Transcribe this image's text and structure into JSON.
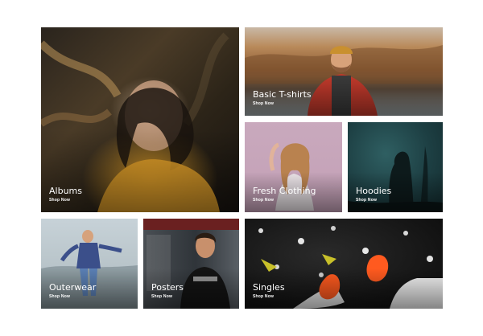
{
  "tiles": [
    {
      "title": "Albums",
      "link": "Shop Now"
    },
    {
      "title": "Basic T-shirts",
      "link": "Shop Now"
    },
    {
      "title": "Fresh Clothing",
      "link": "Shop Now"
    },
    {
      "title": "Hoodies",
      "link": "Shop Now"
    },
    {
      "title": "Outerwear",
      "link": "Shop Now"
    },
    {
      "title": "Posters",
      "link": "Shop Now"
    },
    {
      "title": "Singles",
      "link": "Shop Now"
    }
  ],
  "colors": {
    "caption_text": "#ffffff",
    "page_background": "#ffffff"
  }
}
